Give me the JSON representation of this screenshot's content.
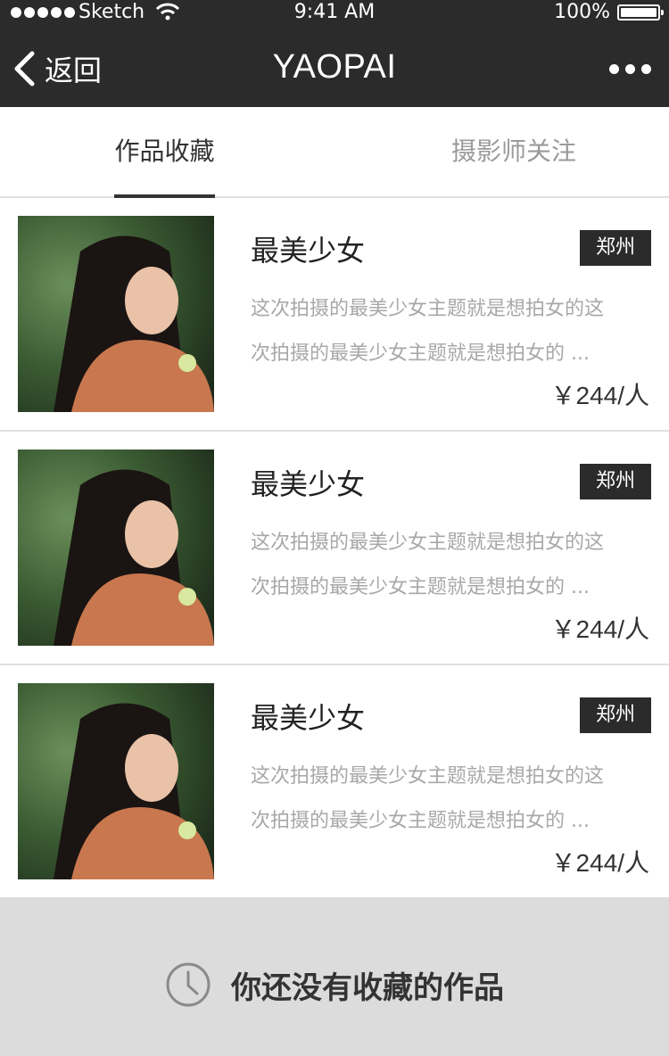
{
  "status_bar": {
    "carrier": "Sketch",
    "time": "9:41 AM",
    "battery": "100%"
  },
  "nav": {
    "back_label": "返回",
    "title": "YAOPAI"
  },
  "tabs": [
    {
      "label": "作品收藏",
      "active": true
    },
    {
      "label": "摄影师关注",
      "active": false
    }
  ],
  "items": [
    {
      "title": "最美少女",
      "city": "郑州",
      "desc_line1": "这次拍摄的最美少女主题就是想拍女的这",
      "desc_line2": "次拍摄的最美少女主题就是想拍女的 ...",
      "price": "￥244/人"
    },
    {
      "title": "最美少女",
      "city": "郑州",
      "desc_line1": "这次拍摄的最美少女主题就是想拍女的这",
      "desc_line2": "次拍摄的最美少女主题就是想拍女的 ...",
      "price": "￥244/人"
    },
    {
      "title": "最美少女",
      "city": "郑州",
      "desc_line1": "这次拍摄的最美少女主题就是想拍女的这",
      "desc_line2": "次拍摄的最美少女主题就是想拍女的 ...",
      "price": "￥244/人"
    }
  ],
  "empty_state": {
    "icon": "clock-icon",
    "text": "你还没有收藏的作品"
  },
  "colors": {
    "header_bg": "#2b2b2b",
    "badge_bg": "#2b2b2b",
    "empty_bg": "#dcdcdc",
    "muted_text": "#a8a8a8"
  }
}
